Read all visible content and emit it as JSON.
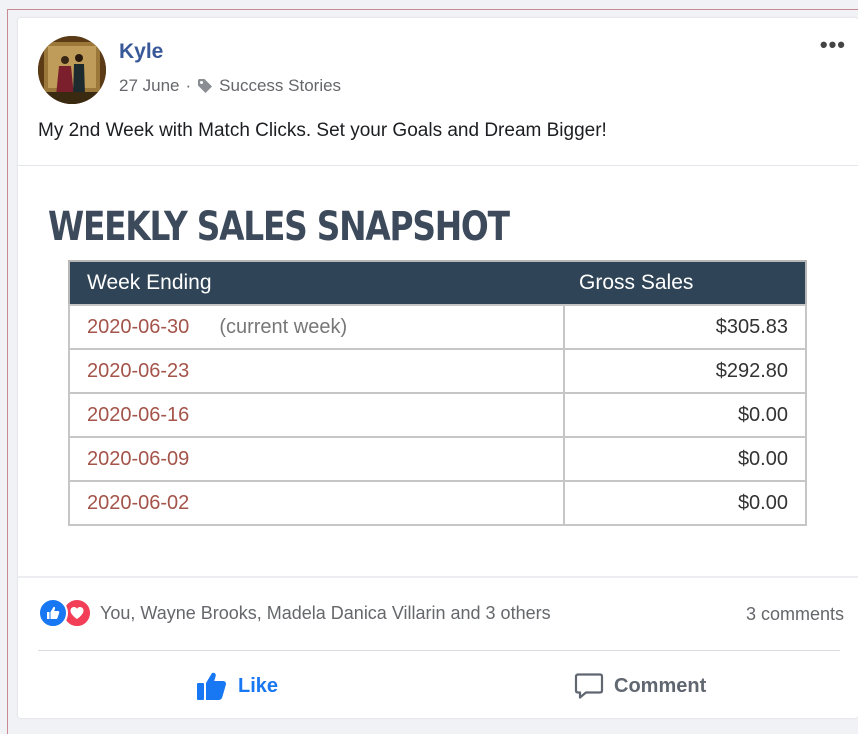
{
  "post": {
    "author": "Kyle",
    "date": "27 June",
    "separator": "·",
    "category": "Success Stories",
    "more_label": "•••",
    "text": "My 2nd Week with Match Clicks. Set your Goals and Dream Bigger!"
  },
  "snapshot": {
    "title": "WEEKLY SALES SNAPSHOT",
    "columns": [
      "Week Ending",
      "Gross Sales"
    ],
    "rows": [
      {
        "week": "2020-06-30",
        "note": "(current week)",
        "gross": "$305.83"
      },
      {
        "week": "2020-06-23",
        "note": "",
        "gross": "$292.80"
      },
      {
        "week": "2020-06-16",
        "note": "",
        "gross": "$0.00"
      },
      {
        "week": "2020-06-09",
        "note": "",
        "gross": "$0.00"
      },
      {
        "week": "2020-06-02",
        "note": "",
        "gross": "$0.00"
      }
    ]
  },
  "reactions": {
    "icons": [
      "like-icon",
      "love-icon"
    ],
    "summary": "You, Wayne Brooks, Madela Danica Villarin and 3 others",
    "comments": "3 comments"
  },
  "actions": {
    "like": "Like",
    "comment": "Comment"
  },
  "colors": {
    "author": "#385898",
    "table_header": "#2f4456",
    "date_text": "#a4544a",
    "like_blue": "#1877f2",
    "love_red": "#f33e58"
  }
}
